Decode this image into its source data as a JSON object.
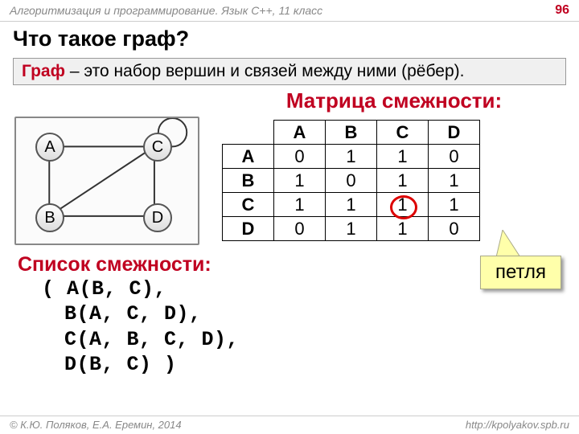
{
  "header": {
    "course": "Алгоритмизация и программирование. Язык C++, 11 класс",
    "page": "96"
  },
  "title": "Что такое граф?",
  "definition": {
    "term": "Граф",
    "rest": " – это набор вершин и связей между ними (рёбер)."
  },
  "matrix_title": "Матрица смежности:",
  "nodes": {
    "a": "A",
    "b": "B",
    "c": "C",
    "d": "D"
  },
  "chart_data": {
    "type": "table",
    "title": "Матрица смежности",
    "col_headers": [
      "A",
      "B",
      "C",
      "D"
    ],
    "row_headers": [
      "A",
      "B",
      "C",
      "D"
    ],
    "rows": [
      [
        "0",
        "1",
        "1",
        "0"
      ],
      [
        "1",
        "0",
        "1",
        "1"
      ],
      [
        "1",
        "1",
        "1",
        "1"
      ],
      [
        "0",
        "1",
        "1",
        "0"
      ]
    ]
  },
  "callout": "петля",
  "adj_title": "Список смежности:",
  "adj_lines": {
    "l0": "( A(B, C),",
    "l1": "B(A, C, D),",
    "l2": "C(A, B, C, D),",
    "l3": "D(B, C) )"
  },
  "footer": {
    "left": "© К.Ю. Поляков, Е.А. Еремин, 2014",
    "right": "http://kpolyakov.spb.ru"
  }
}
